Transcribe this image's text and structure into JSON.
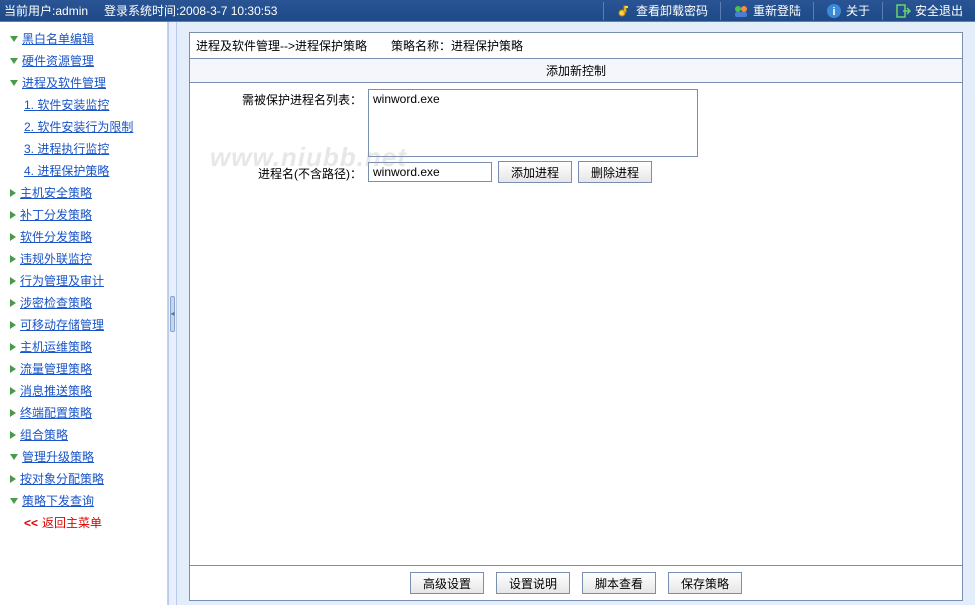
{
  "toolbar": {
    "user_label": "当前用户:",
    "user_value": "admin",
    "login_time_label": "登录系统时间:",
    "login_time_value": "2008-3-7 10:30:53",
    "btn_check_pw": "查看卸载密码",
    "btn_relogin": "重新登陆",
    "btn_about": "关于",
    "btn_exit": "安全退出"
  },
  "sidebar": {
    "items": [
      {
        "label": "黑白名单编辑",
        "type": "tri-down"
      },
      {
        "label": "硬件资源管理",
        "type": "tri-down"
      },
      {
        "label": "进程及软件管理",
        "type": "tri-down"
      },
      {
        "label": "软件安装监控",
        "type": "sub",
        "num": "1."
      },
      {
        "label": "软件安装行为限制",
        "type": "sub",
        "num": "2."
      },
      {
        "label": "进程执行监控",
        "type": "sub",
        "num": "3."
      },
      {
        "label": "进程保护策略",
        "type": "sub",
        "num": "4."
      },
      {
        "label": "主机安全策略",
        "type": "tri"
      },
      {
        "label": "补丁分发策略",
        "type": "tri"
      },
      {
        "label": "软件分发策略",
        "type": "tri"
      },
      {
        "label": "违规外联监控",
        "type": "tri"
      },
      {
        "label": "行为管理及审计",
        "type": "tri"
      },
      {
        "label": "涉密检查策略",
        "type": "tri"
      },
      {
        "label": "可移动存储管理",
        "type": "tri"
      },
      {
        "label": "主机运维策略",
        "type": "tri"
      },
      {
        "label": "流量管理策略",
        "type": "tri"
      },
      {
        "label": "消息推送策略",
        "type": "tri"
      },
      {
        "label": "终端配置策略",
        "type": "tri"
      },
      {
        "label": "组合策略",
        "type": "tri"
      },
      {
        "label": "管理升级策略",
        "type": "tri-down"
      },
      {
        "label": "按对象分配策略",
        "type": "tri"
      },
      {
        "label": "策略下发查询",
        "type": "tri-down"
      },
      {
        "label": "返回主菜单",
        "type": "back"
      }
    ]
  },
  "content": {
    "breadcrumb": "进程及软件管理-->进程保护策略",
    "policy_name_label": "策略名称：",
    "policy_name_value": "进程保护策略",
    "sub_header": "添加新控制",
    "label_process_list": "需被保护进程名列表：",
    "process_list": "winword.exe",
    "label_process_name": "进程名(不含路径)：",
    "process_name": "winword.exe",
    "btn_add": "添加进程",
    "btn_del": "删除进程"
  },
  "bottom": {
    "btn_adv": "高级设置",
    "btn_help": "设置说明",
    "btn_script": "脚本查看",
    "btn_save": "保存策略"
  },
  "watermark": "www.niubb.net"
}
